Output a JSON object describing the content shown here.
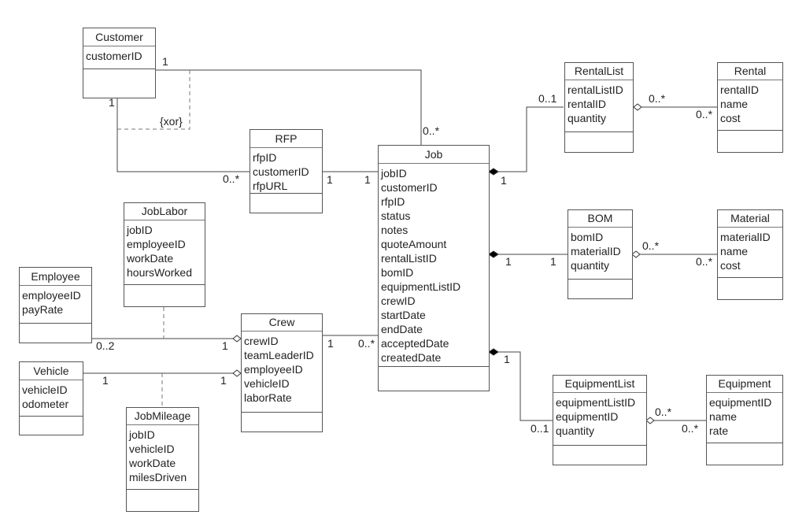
{
  "classes": {
    "customer": {
      "name": "Customer",
      "attributes": [
        "customerID"
      ]
    },
    "rfp": {
      "name": "RFP",
      "attributes": [
        "rfpID",
        "customerID",
        "rfpURL"
      ]
    },
    "job": {
      "name": "Job",
      "attributes": [
        "jobID",
        "customerID",
        "rfpID",
        "status",
        "notes",
        "quoteAmount",
        "rentalListID",
        "bomID",
        "equipmentListID",
        "crewID",
        "startDate",
        "endDate",
        "acceptedDate",
        "createdDate"
      ]
    },
    "rentallist": {
      "name": "RentalList",
      "attributes": [
        "rentalListID",
        "rentalID",
        "quantity"
      ]
    },
    "rental": {
      "name": "Rental",
      "attributes": [
        "rentalID",
        "name",
        "cost"
      ]
    },
    "bom": {
      "name": "BOM",
      "attributes": [
        "bomID",
        "materialID",
        "quantity"
      ]
    },
    "material": {
      "name": "Material",
      "attributes": [
        "materialID",
        "name",
        "cost"
      ]
    },
    "equipmentlist": {
      "name": "EquipmentList",
      "attributes": [
        "equipmentListID",
        "equipmentID",
        "quantity"
      ]
    },
    "equipment": {
      "name": "Equipment",
      "attributes": [
        "equipmentID",
        "name",
        "rate"
      ]
    },
    "joblabor": {
      "name": "JobLabor",
      "attributes": [
        "jobID",
        "employeeID",
        "workDate",
        "hoursWorked"
      ]
    },
    "employee": {
      "name": "Employee",
      "attributes": [
        "employeeID",
        "payRate"
      ]
    },
    "crew": {
      "name": "Crew",
      "attributes": [
        "crewID",
        "teamLeaderID",
        "employeeID",
        "vehicleID",
        "laborRate"
      ]
    },
    "vehicle": {
      "name": "Vehicle",
      "attributes": [
        "vehicleID",
        "odometer"
      ]
    },
    "jobmileage": {
      "name": "JobMileage",
      "attributes": [
        "jobID",
        "vehicleID",
        "workDate",
        "milesDriven"
      ]
    }
  },
  "constraint": "{xor}",
  "multiplicities": {
    "customer_job_customer": "1",
    "customer_job_job": "0..*",
    "customer_rfp_customer": "1",
    "customer_rfp_rfp": "0..*",
    "rfp_job_rfp": "1",
    "rfp_job_job": "1",
    "job_rentallist_job": "1",
    "job_rentallist_rentallist": "0..1",
    "rentallist_rental_left": "0..*",
    "rentallist_rental_right": "0..*",
    "job_bom_job": "1",
    "job_bom_bom": "1",
    "bom_material_left": "0..*",
    "bom_material_right": "0..*",
    "job_equipmentlist_job": "1",
    "job_equipmentlist_list": "0..1",
    "equipmentlist_equipment_left": "0..*",
    "equipmentlist_equipment_right": "0..*",
    "employee_crew_employee": "0..2",
    "employee_crew_crew": "1",
    "vehicle_crew_vehicle": "1",
    "vehicle_crew_crew": "1",
    "crew_job_crew": "1",
    "crew_job_job": "0..*"
  }
}
